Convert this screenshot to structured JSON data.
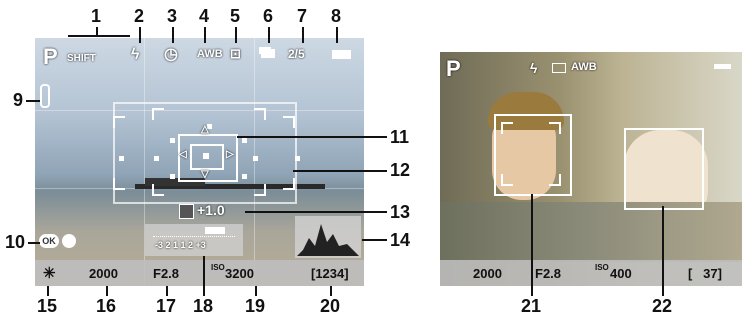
{
  "callouts": {
    "n1": "1",
    "n2": "2",
    "n3": "3",
    "n4": "4",
    "n5": "5",
    "n6": "6",
    "n7": "7",
    "n8": "8",
    "n9": "9",
    "n10": "10",
    "n11": "11",
    "n12": "12",
    "n13": "13",
    "n14": "14",
    "n15": "15",
    "n16": "16",
    "n17": "17",
    "n18": "18",
    "n19": "19",
    "n20": "20",
    "n21": "21",
    "n22": "22"
  },
  "screen1": {
    "mode": "P",
    "shift": "SHIFT",
    "wb": "AWB",
    "drive_counter": "2/5",
    "exposure_comp": "+1.0",
    "scale_labels": "-3 2 1   1 2 +3",
    "ok_label": "OK",
    "shutter": "2000",
    "aperture": "F2.8",
    "iso_prefix": "ISO",
    "iso": "3200",
    "shots": "[1234]"
  },
  "screen2": {
    "mode": "P",
    "wb": "AWB",
    "shutter": "2000",
    "aperture": "F2.8",
    "iso_prefix": "ISO",
    "iso": "400",
    "shots": "[   37]"
  },
  "icons": [
    "flash-icon",
    "self-timer-icon",
    "face-detect-icon",
    "drive-mode-icon",
    "battery-icon",
    "thermometer-icon",
    "ok-button-icon",
    "af-point-icon",
    "histogram-icon"
  ]
}
